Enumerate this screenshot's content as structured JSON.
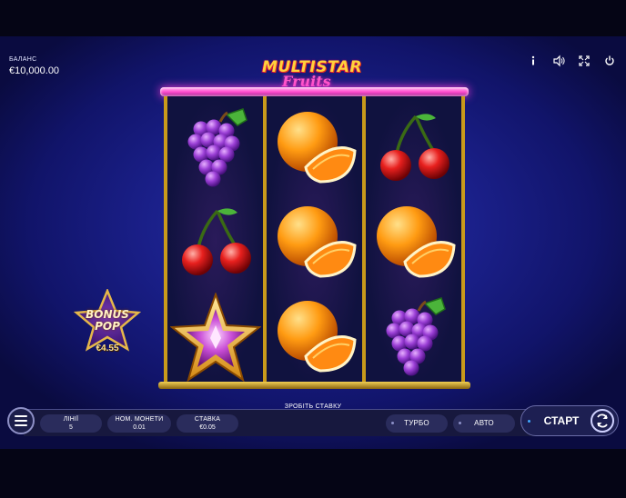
{
  "balance": {
    "label": "БАЛАНС",
    "value": "€10,000.00"
  },
  "top_icons": [
    "info-icon",
    "sound-icon",
    "fullscreen-icon",
    "power-icon"
  ],
  "logo": {
    "main": "MULTISTAR",
    "sub": "Fruits"
  },
  "reels": [
    [
      "grapes",
      "cherries",
      "star"
    ],
    [
      "orange",
      "orange",
      "orange"
    ],
    [
      "cherries",
      "orange",
      "grapes"
    ]
  ],
  "bonus": {
    "line1": "BONUS",
    "line2": "POP",
    "price": "€4.55"
  },
  "controls": {
    "prompt": "ЗРОБІТЬ СТАВКУ",
    "lines": {
      "label": "ЛІНІЇ",
      "value": "5"
    },
    "coin": {
      "label": "НОМ. МОНЕТИ",
      "value": "0.01"
    },
    "bet": {
      "label": "СТАВКА",
      "value": "€0.05"
    },
    "turbo": "ТУРБО",
    "auto": "АВТО",
    "start": "СТАРТ"
  },
  "colors": {
    "background": "#1a1f88",
    "frame_gold": "#c99a1b",
    "neon_pink": "#ff4fd0",
    "logo_yellow": "#ffd23a"
  }
}
